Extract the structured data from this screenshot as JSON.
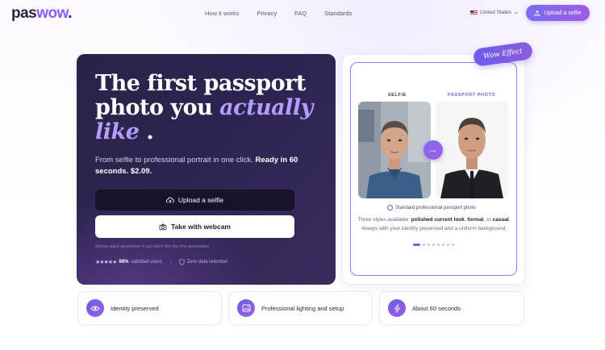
{
  "nav": {
    "logo_part1": "pas",
    "logo_part2": "wow",
    "logo_dot": ".",
    "links": [
      "How it works",
      "Privacy",
      "FAQ",
      "Standards"
    ],
    "locale": "United States",
    "upload_label": "Upload a selfie"
  },
  "hero": {
    "title_line1": "The first passport",
    "title_line2": "photo you",
    "title_accent1": "actually",
    "title_accent2": "like",
    "title_end": ".",
    "subtitle_plain": "From selfie to professional portrait in one click.",
    "subtitle_bold": "Ready in 60 seconds. $2.09.",
    "upload_button": "Upload a selfie",
    "webcam_button": "Take with webcam",
    "guarantee": "Money-back guarantee if you don't like the first generation.",
    "rating_stars": "★★★★★",
    "rating_percent": "98%",
    "rating_text": "satisfied users",
    "retention": "Zero data retention"
  },
  "preview": {
    "badge": "Wow Effect",
    "selfie_label": "SELFIE",
    "passport_label": "PASSPORT PHOTO",
    "standard_label": "Standard professional passport photo",
    "desc_1": "Three styles available:",
    "desc_b1": "polished current look",
    "desc_2": ",",
    "desc_b2": "formal",
    "desc_3": ", or",
    "desc_b3": "casual",
    "desc_4": ". Always with your identity preserved and a uniform background.",
    "carousel_total": 8,
    "carousel_active": 1
  },
  "features": [
    {
      "label": "Identity preserved",
      "icon": "eye-icon"
    },
    {
      "label": "Professional lighting and setup",
      "icon": "image-icon"
    },
    {
      "label": "About 60 seconds",
      "icon": "lightning-icon"
    }
  ],
  "colors": {
    "accent": "#8b5cf6",
    "hero_bg": "#2a2348",
    "accent_light": "#b59cff"
  }
}
